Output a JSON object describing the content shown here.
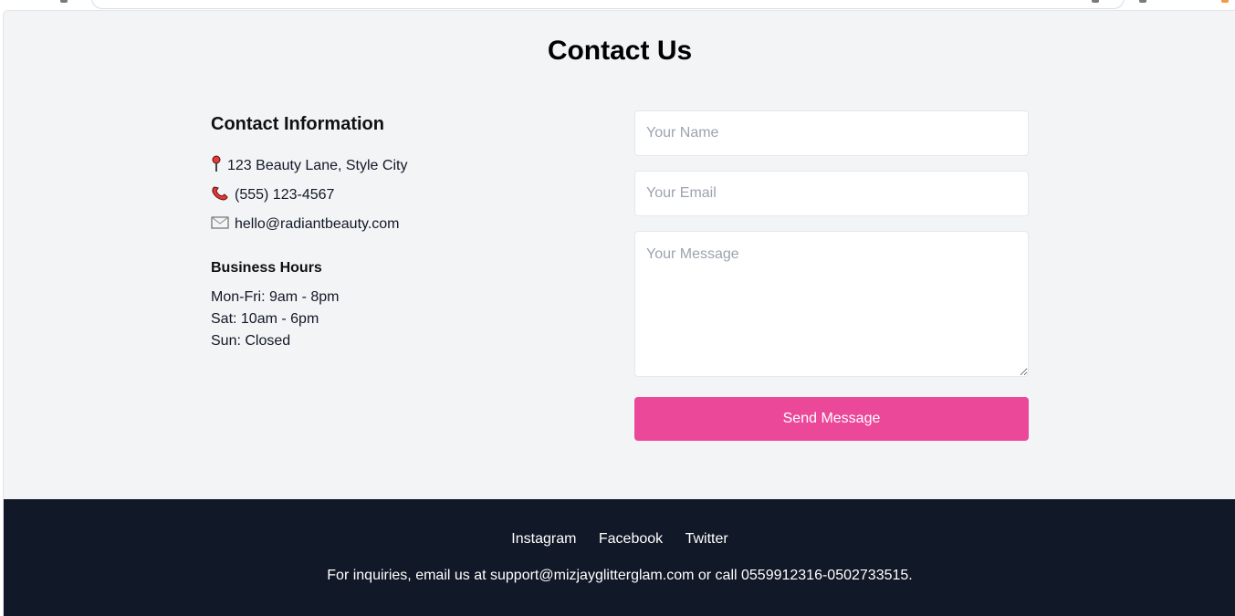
{
  "page": {
    "title": "Contact Us"
  },
  "contact_info": {
    "heading": "Contact Information",
    "items": [
      {
        "icon": "map-pin-icon",
        "text": "123 Beauty Lane, Style City"
      },
      {
        "icon": "telephone-icon",
        "text": "(555) 123-4567"
      },
      {
        "icon": "envelope-icon",
        "text": "hello@radiantbeauty.com"
      }
    ]
  },
  "business_hours": {
    "heading": "Business Hours",
    "lines": [
      "Mon-Fri: 9am - 8pm",
      "Sat: 10am - 6pm",
      "Sun: Closed"
    ]
  },
  "form": {
    "name_placeholder": "Your Name",
    "email_placeholder": "Your Email",
    "message_placeholder": "Your Message",
    "submit_label": "Send Message"
  },
  "footer": {
    "links": [
      "Instagram",
      "Facebook",
      "Twitter"
    ],
    "note": "For inquiries, email us at support@mizjayglitterglam.com or call 0559912316-0502733515."
  },
  "colors": {
    "section_background": "#f3f4f6",
    "accent": "#ec4899",
    "footer_background": "#111827"
  }
}
